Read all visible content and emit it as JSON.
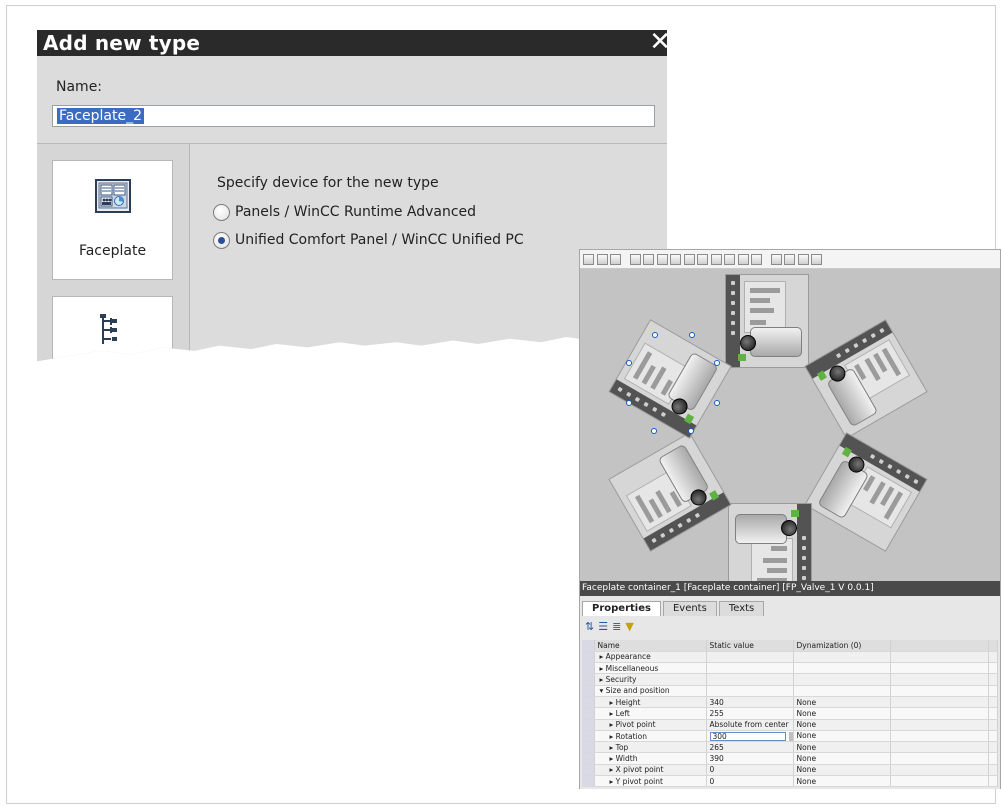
{
  "dialog": {
    "title": "Add new type",
    "close_glyph": "✕",
    "name_label": "Name:",
    "name_value": "Faceplate_2",
    "tiles": [
      {
        "label": "Faceplate",
        "icon": "faceplate-icon"
      },
      {
        "label": "",
        "icon": "hierarchy-icon"
      }
    ],
    "specify_label": "Specify device for the new type",
    "options": [
      {
        "label": "Panels / WinCC Runtime Advanced",
        "checked": false
      },
      {
        "label": "Unified Comfort Panel / WinCC Unified PC",
        "checked": true
      }
    ]
  },
  "editor": {
    "toolbar_icons": [
      "zoom-in-icon",
      "zoom-out-icon",
      "zoom-fit-icon",
      "align-left-icon",
      "align-center-icon",
      "align-right-icon",
      "align-top-icon",
      "align-middle-icon",
      "align-bottom-icon",
      "distribute-h-icon",
      "distribute-v-icon",
      "same-width-icon",
      "same-height-icon",
      "bring-front-icon",
      "send-back-icon",
      "group-icon",
      "ungroup-icon"
    ],
    "valve_count": 6,
    "panel_labels": [
      "STOP",
      "OPEN",
      "STOP",
      "OPEN",
      "OPEN",
      "OPEN"
    ],
    "properties_title": "Faceplate container_1 [Faceplate container] [FP_Valve_1 V 0.0.1]",
    "tabs": [
      "Properties",
      "Events",
      "Texts"
    ],
    "tool_icons": [
      "sort-icon",
      "list-view-icon",
      "tree-view-icon",
      "filter-icon"
    ],
    "columns": [
      "Name",
      "Static value",
      "Dynamization (0)"
    ],
    "rows": [
      {
        "name": "Appearance",
        "indent": 1,
        "value": "",
        "dyn": ""
      },
      {
        "name": "Miscellaneous",
        "indent": 1,
        "value": "",
        "dyn": ""
      },
      {
        "name": "Security",
        "indent": 1,
        "value": "",
        "dyn": ""
      },
      {
        "name": "Size and position",
        "indent": 1,
        "value": "",
        "dyn": "",
        "expanded": true
      },
      {
        "name": "Height",
        "indent": 2,
        "value": "340",
        "dyn": "None"
      },
      {
        "name": "Left",
        "indent": 2,
        "value": "255",
        "dyn": "None"
      },
      {
        "name": "Pivot point",
        "indent": 2,
        "value": "Absolute from center",
        "dyn": "None"
      },
      {
        "name": "Rotation",
        "indent": 2,
        "value": "300",
        "dyn": "None",
        "editing": true
      },
      {
        "name": "Top",
        "indent": 2,
        "value": "265",
        "dyn": "None"
      },
      {
        "name": "Width",
        "indent": 2,
        "value": "390",
        "dyn": "None"
      },
      {
        "name": "X pivot point",
        "indent": 2,
        "value": "0",
        "dyn": "None"
      },
      {
        "name": "Y pivot point",
        "indent": 2,
        "value": "0",
        "dyn": "None"
      }
    ]
  }
}
